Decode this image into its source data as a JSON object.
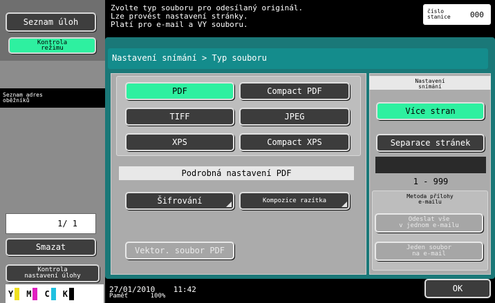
{
  "header": {
    "message": "Zvolte typ souboru pro odesílaný originál.\nLze provést nastavení stránky.\nPlatí pro e-mail a VY souboru.",
    "station_label": "číslo\nstanice",
    "station_value": "000"
  },
  "sidebar": {
    "job_list": "Seznam úloh",
    "mode_check": "Kontrola\nrežimu",
    "address_list": "Seznam adres\noběžníků",
    "counter": "1/ 1",
    "delete": "Smazat",
    "job_settings_check": "Kontrola\nnastavení úlohy",
    "toner": [
      {
        "letter": "Y",
        "color": "#f0e020"
      },
      {
        "letter": "M",
        "color": "#e020c0"
      },
      {
        "letter": "C",
        "color": "#20c0e0"
      },
      {
        "letter": "K",
        "color": "#000000"
      }
    ]
  },
  "breadcrumb": "Nastavení snímání > Typ souboru",
  "file_types": {
    "pdf": "PDF",
    "compact_pdf": "Compact PDF",
    "tiff": "TIFF",
    "jpeg": "JPEG",
    "xps": "XPS",
    "compact_xps": "Compact XPS"
  },
  "pdf_details": {
    "title": "Podrobná nastavení PDF",
    "encryption": "Šifrování",
    "stamp": "Kompozice razítka",
    "vector": "Vektor. soubor PDF"
  },
  "scan_settings": {
    "title": "Nastavení\nsnímání",
    "multi_page": "Více stran",
    "page_separation": "Separace stránek",
    "range": "1  -  999"
  },
  "email_attach": {
    "title": "Metoda přílohy\ne-mailu",
    "send_all": "Odeslat vše\nv jednom e-mailu",
    "one_file": "Jeden soubor\nna e-mail"
  },
  "footer": {
    "date": "27/01/2010",
    "time": "11:42",
    "memory_label": "Paměť",
    "memory_value": "100%",
    "ok": "OK"
  }
}
